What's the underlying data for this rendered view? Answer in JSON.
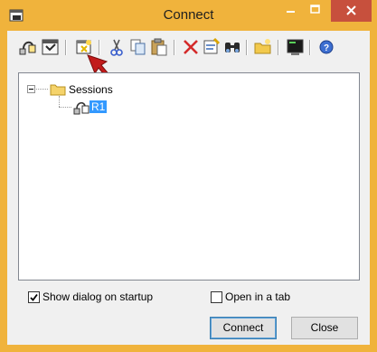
{
  "window": {
    "title": "Connect",
    "frame_color": "#f0b33c",
    "close_color": "#c7503d"
  },
  "toolbar": {
    "buttons": [
      {
        "icon": "connect-session-icon"
      },
      {
        "icon": "connect-session-tab-icon"
      },
      {
        "icon": "new-session-icon"
      },
      {
        "icon": "cut-icon"
      },
      {
        "icon": "copy-icon"
      },
      {
        "icon": "paste-icon"
      },
      {
        "icon": "delete-icon"
      },
      {
        "icon": "properties-icon"
      },
      {
        "icon": "find-icon"
      },
      {
        "icon": "new-folder-icon"
      },
      {
        "icon": "terminal-icon"
      },
      {
        "icon": "help-icon"
      }
    ]
  },
  "tree": {
    "root_label": "Sessions",
    "child_label": "R1",
    "selection_color": "#3399ff"
  },
  "options": {
    "show_dialog_label": "Show dialog on startup",
    "show_dialog_checked": true,
    "open_tab_label": "Open in a tab",
    "open_tab_checked": false
  },
  "buttons": {
    "connect_label": "Connect",
    "close_label": "Close"
  }
}
